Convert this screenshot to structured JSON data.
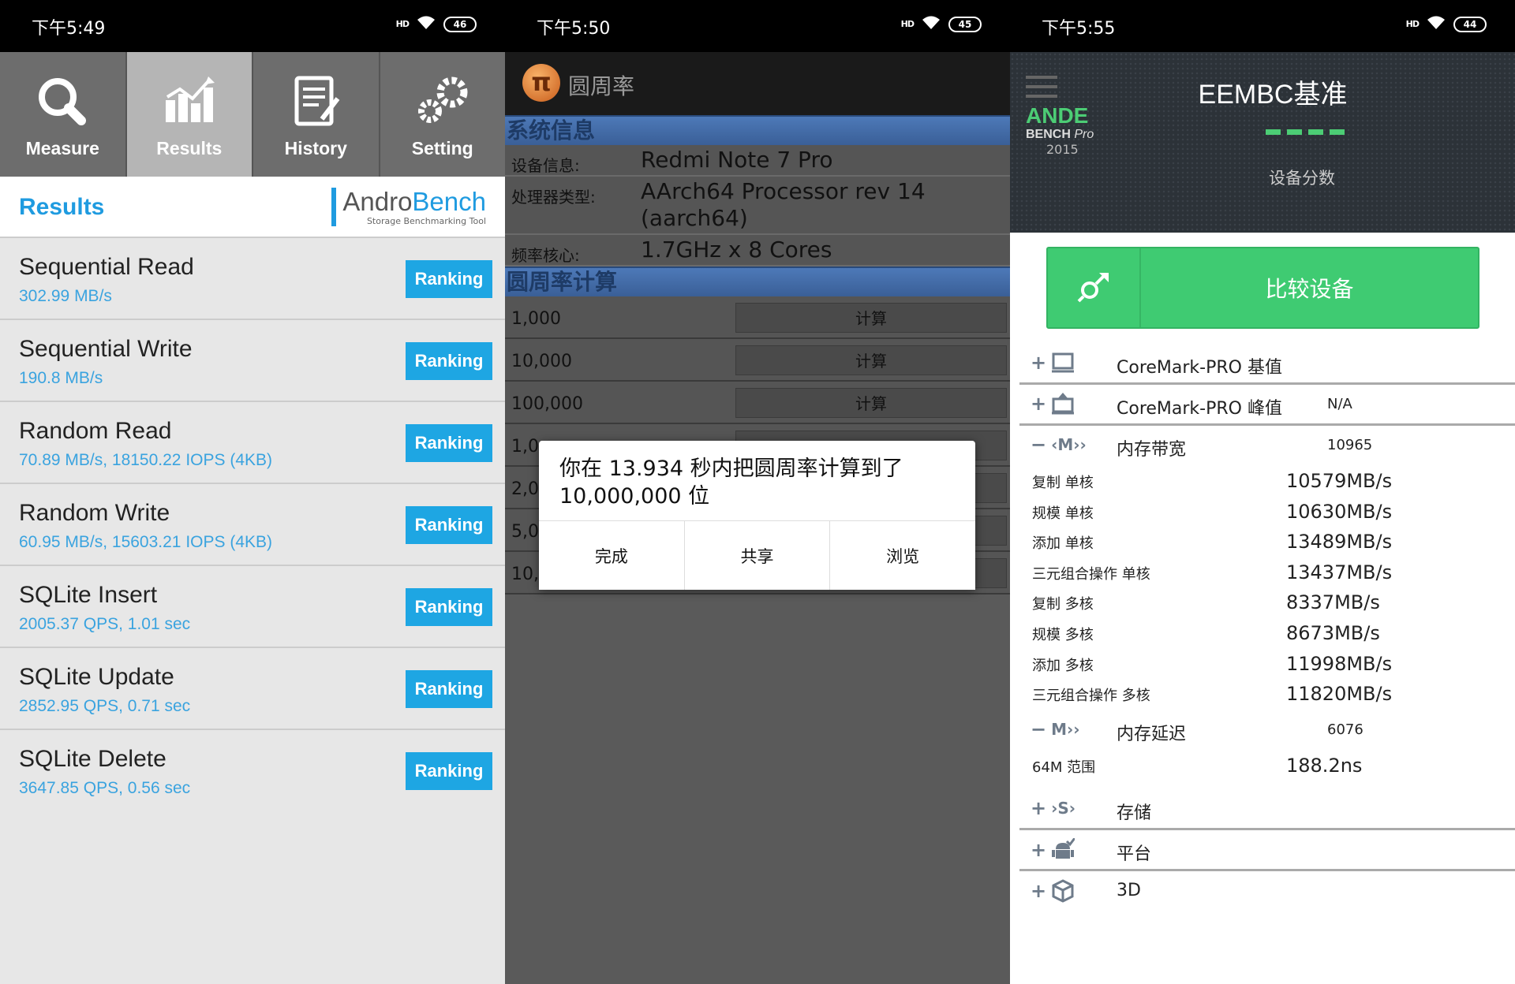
{
  "androbench": {
    "status_time": "下午5:49",
    "status_signal": "HD",
    "battery": "46",
    "tabs": [
      {
        "label": "Measure",
        "icon": "search-icon"
      },
      {
        "label": "Results",
        "icon": "chart-icon"
      },
      {
        "label": "History",
        "icon": "clipboard-icon"
      },
      {
        "label": "Setting",
        "icon": "gear-icon"
      }
    ],
    "active_tab": "Results",
    "header_title": "Results",
    "logo_name_part1": "Andro",
    "logo_name_part2": "Bench",
    "logo_subtitle": "Storage Benchmarking Tool",
    "ranking_label": "Ranking",
    "results": [
      {
        "name": "Sequential Read",
        "value": "302.99 MB/s"
      },
      {
        "name": "Sequential Write",
        "value": "190.8 MB/s"
      },
      {
        "name": "Random Read",
        "value": "70.89 MB/s, 18150.22 IOPS (4KB)"
      },
      {
        "name": "Random Write",
        "value": "60.95 MB/s, 15603.21 IOPS (4KB)"
      },
      {
        "name": "SQLite Insert",
        "value": "2005.37 QPS, 1.01 sec"
      },
      {
        "name": "SQLite Update",
        "value": "2852.95 QPS, 0.71 sec"
      },
      {
        "name": "SQLite Delete",
        "value": "3647.85 QPS, 0.56 sec"
      }
    ],
    "accent_color": "#1f9be0"
  },
  "pi": {
    "status_time": "下午5:50",
    "status_signal": "HD",
    "battery": "45",
    "app_title": "圆周率",
    "logo_glyph": "π",
    "section_system": "系统信息",
    "info": [
      {
        "label": "设备信息:",
        "value": "Redmi Note 7 Pro"
      },
      {
        "label": "处理器类型:",
        "value": "AArch64 Processor rev 14 (aarch64)"
      },
      {
        "label": "频率核心:",
        "value": "1.7GHz x 8 Cores"
      }
    ],
    "section_calc": "圆周率计算",
    "calc_button_label": "计算",
    "calc_rows": [
      "1,000",
      "10,000",
      "100,000",
      "1,0",
      "2,0",
      "5,0",
      "10,"
    ],
    "dialog": {
      "message": "你在 13.934 秒内把圆周率计算到了 10,000,000 位",
      "buttons": [
        "完成",
        "共享",
        "浏览"
      ]
    }
  },
  "andebench": {
    "status_time": "下午5:55",
    "status_signal": "HD",
    "battery": "44",
    "logo_ande": "ANDE",
    "logo_bench": "BENCH",
    "logo_pro": "Pro",
    "logo_year": "2015",
    "title": "EEMBC基准",
    "score_label": "设备分数",
    "compare_label": "比较设备",
    "accent_color": "#3fcb72",
    "sections": [
      {
        "sign": "+",
        "icon": "monitor-icon",
        "name": "CoreMark-PRO 基值",
        "value": "",
        "subs": []
      },
      {
        "sign": "+",
        "icon": "monitor-up-icon",
        "name": "CoreMark-PRO 峰值",
        "value": "N/A",
        "subs": []
      },
      {
        "sign": "−",
        "icon": "memory-icon",
        "glyph": "M",
        "name": "内存带宽",
        "value": "10965",
        "subs": [
          {
            "name": "复制 单核",
            "value": "10579MB/s"
          },
          {
            "name": "规模 单核",
            "value": "10630MB/s"
          },
          {
            "name": "添加 单核",
            "value": "13489MB/s"
          },
          {
            "name": "三元组合操作 单核",
            "value": "13437MB/s"
          },
          {
            "name": "复制 多核",
            "value": "8337MB/s"
          },
          {
            "name": "规模 多核",
            "value": "8673MB/s"
          },
          {
            "name": "添加 多核",
            "value": "11998MB/s"
          },
          {
            "name": "三元组合操作 多核",
            "value": "11820MB/s"
          }
        ]
      },
      {
        "sign": "−",
        "icon": "memory-latency-icon",
        "glyph": "M",
        "name": "内存延迟",
        "value": "6076",
        "subs": [
          {
            "name": "64M 范围",
            "value": "188.2ns"
          }
        ]
      },
      {
        "sign": "+",
        "icon": "storage-icon",
        "glyph": "S",
        "name": "存储",
        "value": "",
        "subs": []
      },
      {
        "sign": "+",
        "icon": "android-icon",
        "name": "平台",
        "value": "",
        "subs": []
      },
      {
        "sign": "+",
        "icon": "cube-icon",
        "name": "3D",
        "value": "",
        "subs": []
      }
    ]
  }
}
